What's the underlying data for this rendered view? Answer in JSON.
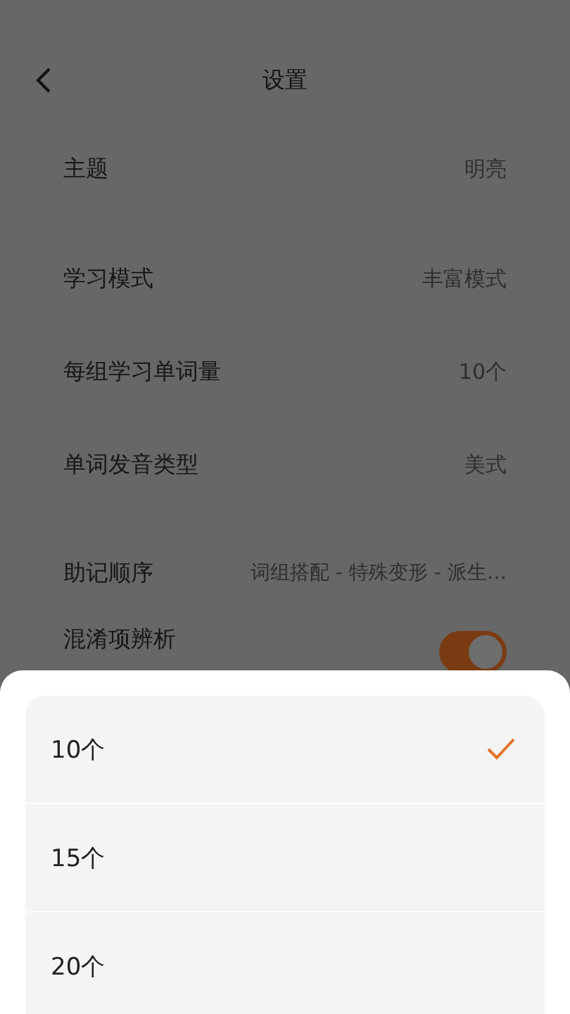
{
  "header": {
    "back": true,
    "title": "设置"
  },
  "settings": [
    {
      "kind": "value",
      "label": "主题",
      "value": "明亮"
    },
    {
      "kind": "value",
      "label": "学习模式",
      "value": "丰富模式"
    },
    {
      "kind": "value",
      "label": "每组学习单词量",
      "value": "10个"
    },
    {
      "kind": "value",
      "label": "单词发音类型",
      "value": "美式"
    },
    {
      "kind": "value",
      "label": "助记顺序",
      "value": "词组搭配 - 特殊变形 - 派生…"
    },
    {
      "kind": "toggle",
      "label": "混淆项辨析",
      "on": true
    }
  ],
  "sheet": {
    "options": [
      {
        "label": "10个",
        "selected": true
      },
      {
        "label": "15个",
        "selected": false
      },
      {
        "label": "20个",
        "selected": false
      }
    ]
  }
}
